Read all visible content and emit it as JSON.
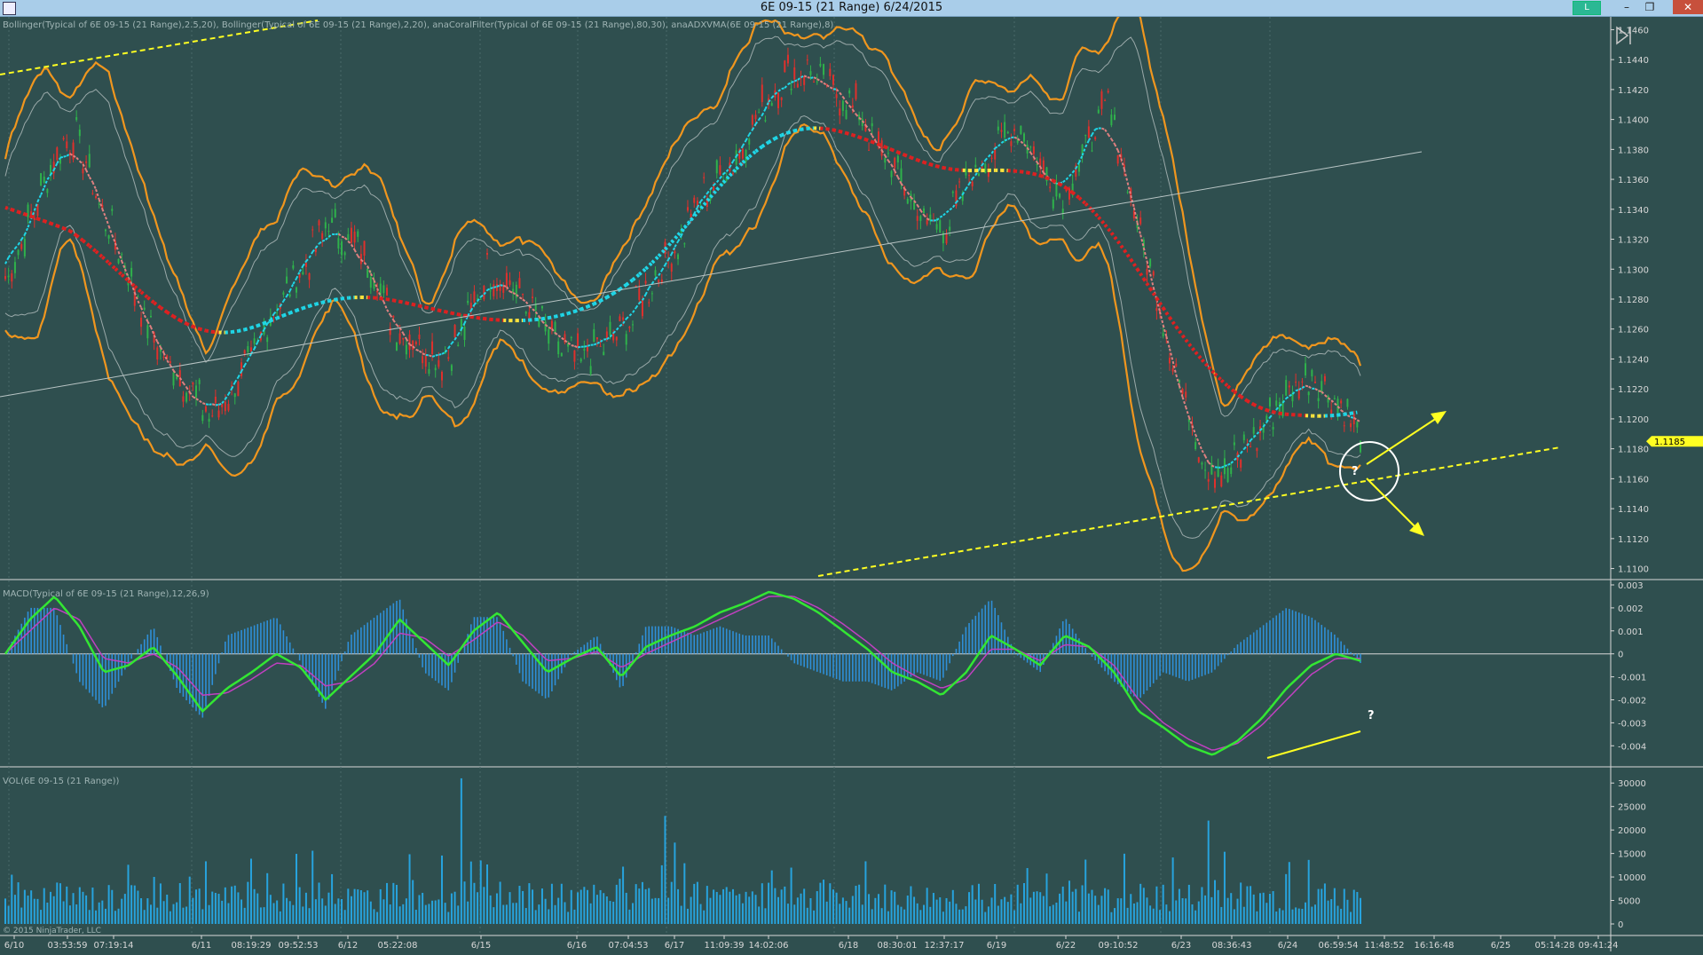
{
  "window": {
    "title": "6E 09-15 (21 Range)  6/24/2015",
    "badge": "L",
    "minimize": "–",
    "restore": "❐",
    "close": "✕"
  },
  "price_panel": {
    "indicators_label": "Bollinger(Typical of 6E 09-15 (21 Range),2.5,20), Bollinger(Typical of 6E 09-15 (21 Range),2,20), anaCoralFilter(Typical of 6E 09-15 (21 Range),80,30), anaADXVMA(6E 09-15 (21 Range),8)",
    "current_price": "1.1185",
    "annotation": "?"
  },
  "macd_panel": {
    "label": "MACD(Typical of 6E 09-15 (21 Range),12,26,9)",
    "annotation": "?"
  },
  "volume_panel": {
    "label": "VOL(6E 09-15 (21 Range))",
    "copyright": "© 2015 NinjaTrader, LLC"
  },
  "colors": {
    "background": "#2f4f4f",
    "bollinger_outer": "#f0961e",
    "coral_filter": "#1fd7e8",
    "coral_filter_down": "#e02020",
    "adxvma": "#ffe53d",
    "macd_line": "#33e633",
    "macd_signal": "#c040c0",
    "histogram": "#2f8fd8",
    "volume": "#27a3dd",
    "annotation": "#ffff22",
    "up_bar": "#2fb24b",
    "down_bar": "#e0302c"
  },
  "chart_data": [
    {
      "type": "candlestick",
      "name": "6E 09-15 (21 Range)",
      "y_axis_ticks": [
        "1.1460",
        "1.1440",
        "1.1420",
        "1.1400",
        "1.1380",
        "1.1360",
        "1.1340",
        "1.1320",
        "1.1300",
        "1.1280",
        "1.1260",
        "1.1240",
        "1.1220",
        "1.1200",
        "1.1180",
        "1.1160",
        "1.1140",
        "1.1120",
        "1.1100"
      ],
      "ylim": [
        1.1095,
        1.1465
      ],
      "x_axis_labels": [
        "6/10",
        "03:53:59",
        "07:19:14",
        "6/11",
        "08:19:29",
        "09:52:53",
        "6/12",
        "05:22:08",
        "6/15",
        "6/16",
        "07:04:53",
        "6/17",
        "11:09:39",
        "14:02:06",
        "6/18",
        "08:30:01",
        "12:37:17",
        "6/19",
        "6/22",
        "09:10:52",
        "6/23",
        "08:36:43",
        "6/24",
        "06:59:54",
        "11:48:52",
        "16:16:48",
        "6/25",
        "05:14:28",
        "09:41:24"
      ],
      "trend": [
        1.129,
        1.133,
        1.137,
        1.139,
        1.135,
        1.131,
        1.127,
        1.124,
        1.122,
        1.12,
        1.122,
        1.125,
        1.128,
        1.13,
        1.133,
        1.132,
        1.13,
        1.126,
        1.125,
        1.124,
        1.126,
        1.13,
        1.129,
        1.127,
        1.125,
        1.124,
        1.125,
        1.126,
        1.129,
        1.131,
        1.134,
        1.136,
        1.138,
        1.141,
        1.143,
        1.143,
        1.142,
        1.141,
        1.138,
        1.136,
        1.133,
        1.133,
        1.136,
        1.138,
        1.14,
        1.137,
        1.135,
        1.138,
        1.141,
        1.135,
        1.129,
        1.123,
        1.118,
        1.116,
        1.118,
        1.12,
        1.122,
        1.123,
        1.121,
        1.119
      ]
    },
    {
      "type": "line",
      "name": "MACD",
      "y_axis_ticks": [
        "0.003",
        "0.002",
        "0.001",
        "0",
        "-0.001",
        "-0.002",
        "-0.003",
        "-0.004"
      ],
      "ylim": [
        -0.0048,
        0.003
      ],
      "macd": [
        0.0,
        0.0015,
        0.0025,
        0.0012,
        -0.0008,
        -0.0005,
        0.0003,
        -0.001,
        -0.0025,
        -0.0015,
        -0.0008,
        0.0,
        -0.0006,
        -0.002,
        -0.001,
        0.0,
        0.0015,
        0.0005,
        -0.0005,
        0.001,
        0.0018,
        0.0005,
        -0.0008,
        -0.0002,
        0.0003,
        -0.001,
        0.0003,
        0.0008,
        0.0012,
        0.0018,
        0.0022,
        0.0027,
        0.0024,
        0.0018,
        0.001,
        0.0002,
        -0.0008,
        -0.0012,
        -0.0018,
        -0.0008,
        0.0008,
        0.0002,
        -0.0005,
        0.0008,
        0.0003,
        -0.0008,
        -0.0025,
        -0.0032,
        -0.004,
        -0.0044,
        -0.0038,
        -0.0028,
        -0.0015,
        -0.0005,
        0.0,
        -0.0003
      ],
      "signal": [
        0.0,
        0.001,
        0.002,
        0.0015,
        -0.0002,
        -0.0004,
        0.0,
        -0.0006,
        -0.0018,
        -0.0017,
        -0.0011,
        -0.0004,
        -0.0005,
        -0.0014,
        -0.0012,
        -0.0004,
        0.0009,
        0.0007,
        -0.0001,
        0.0006,
        0.0014,
        0.0008,
        -0.0003,
        -0.0002,
        0.0001,
        -0.0006,
        0.0,
        0.0005,
        0.001,
        0.0015,
        0.002,
        0.0025,
        0.0025,
        0.002,
        0.0013,
        0.0005,
        -0.0004,
        -0.001,
        -0.0015,
        -0.0011,
        0.0002,
        0.0002,
        -0.0003,
        0.0004,
        0.0003,
        -0.0005,
        -0.002,
        -0.003,
        -0.0037,
        -0.0042,
        -0.0039,
        -0.0031,
        -0.002,
        -0.0009,
        -0.0002,
        -0.0002
      ]
    },
    {
      "type": "bar",
      "name": "VOL",
      "y_axis_ticks": [
        "30000",
        "25000",
        "20000",
        "15000",
        "10000",
        "5000",
        "0"
      ],
      "ylim": [
        0,
        32500
      ],
      "peaks": [
        {
          "label": "6/15",
          "value": 31000
        },
        {
          "label": "6/17",
          "value": 23000
        },
        {
          "label": "6/23",
          "value": 22000
        }
      ]
    }
  ]
}
